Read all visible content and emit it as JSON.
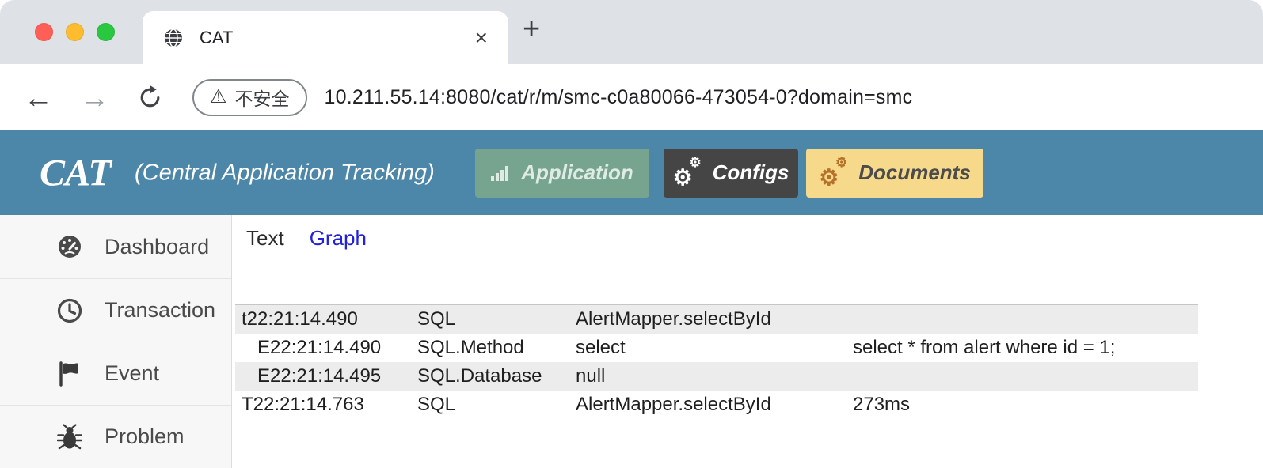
{
  "browser": {
    "tab_title": "CAT",
    "url": "10.211.55.14:8080/cat/r/m/smc-c0a80066-473054-0?domain=smc",
    "security_label": "不安全"
  },
  "icons": {
    "close": "×",
    "new_tab": "+",
    "back": "←",
    "forward": "→",
    "warning": "⚠",
    "cog": "⚙"
  },
  "header": {
    "logo": "CAT",
    "subtitle": "(Central Application Tracking)",
    "nav": [
      {
        "label": "Application",
        "icon": "bar-chart-icon"
      },
      {
        "label": "Configs",
        "icon": "cogs-icon"
      },
      {
        "label": "Documents",
        "icon": "cogs-icon"
      }
    ]
  },
  "sidebar": {
    "items": [
      {
        "label": "Dashboard",
        "icon": "dashboard-icon"
      },
      {
        "label": "Transaction",
        "icon": "clock-icon"
      },
      {
        "label": "Event",
        "icon": "flag-icon"
      },
      {
        "label": "Problem",
        "icon": "bug-icon"
      }
    ]
  },
  "main": {
    "tabs": [
      {
        "label": "Text",
        "active": true
      },
      {
        "label": "Graph",
        "active": false
      }
    ],
    "log_rows": [
      {
        "time": "t22:21:14.490",
        "type": "SQL",
        "name": "AlertMapper.selectById",
        "detail": ""
      },
      {
        "time": "   E22:21:14.490",
        "type": "SQL.Method",
        "name": "select",
        "detail": "select * from alert where id = 1;"
      },
      {
        "time": "   E22:21:14.495",
        "type": "SQL.Database",
        "name": "null",
        "detail": ""
      },
      {
        "time": "T22:21:14.763",
        "type": "SQL",
        "name": "AlertMapper.selectById",
        "detail": "273ms"
      }
    ]
  },
  "colors": {
    "header_bg": "#4c86a8",
    "application_btn": "#76a48e",
    "configs_btn": "#454545",
    "documents_btn": "#f6d98a",
    "row_alt": "#ececec",
    "link_blue": "#2222dd"
  }
}
